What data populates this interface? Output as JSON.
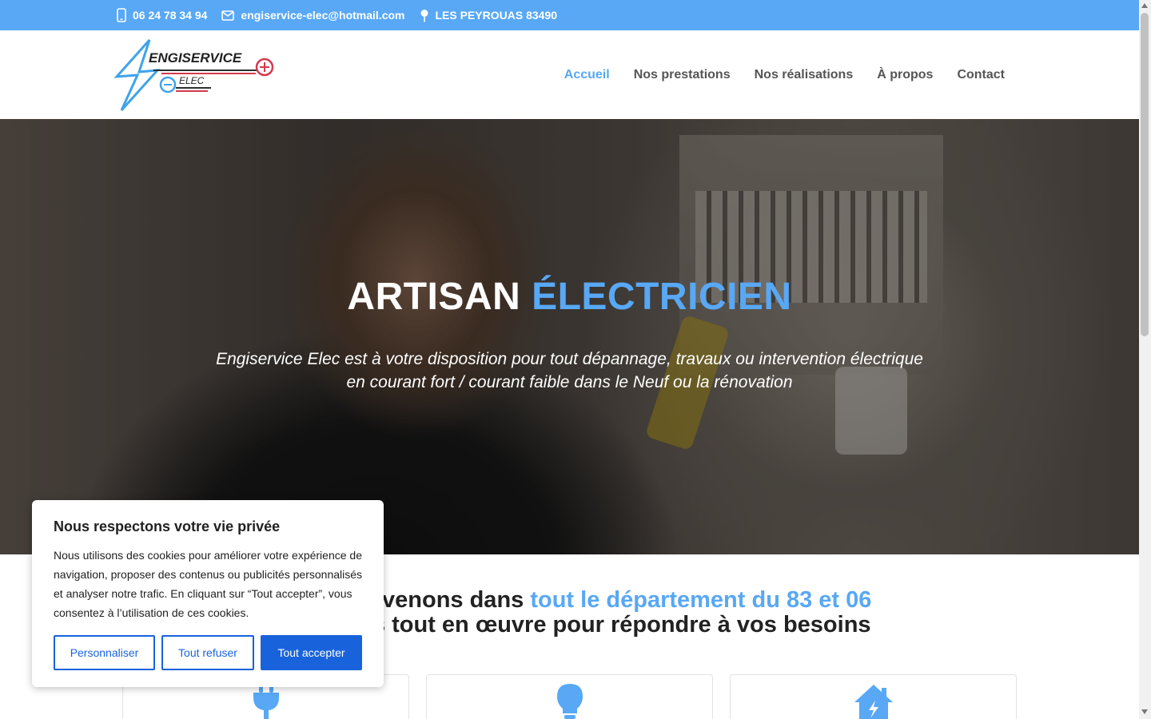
{
  "topbar": {
    "phone": "06 24 78 34 94",
    "email": "engiservice-elec@hotmail.com",
    "address": "LES PEYROUAS 83490"
  },
  "logo": {
    "line1": "ENGISERVICE",
    "line2": "ELEC"
  },
  "nav": {
    "items": [
      {
        "label": "Accueil",
        "active": true
      },
      {
        "label": "Nos prestations",
        "active": false
      },
      {
        "label": "Nos réalisations",
        "active": false
      },
      {
        "label": "À propos",
        "active": false
      },
      {
        "label": "Contact",
        "active": false
      }
    ]
  },
  "hero": {
    "title_part1": "ARTISAN",
    "title_part2": "ÉLECTRICIEN",
    "subtitle_line1": "Engiservice Elec est à votre disposition pour tout dépannage, travaux ou intervention électrique",
    "subtitle_line2": "en courant fort / courant faible dans le Neuf ou la rénovation"
  },
  "intro": {
    "line1_part1": "Nous intervenons dans",
    "line1_part2": "tout le département du 83 et 06",
    "line2": "et mettons tout en œuvre pour répondre à vos besoins"
  },
  "cards": [
    {
      "icon": "plug-icon"
    },
    {
      "icon": "lightbulb-icon"
    },
    {
      "icon": "house-icon"
    }
  ],
  "cookie": {
    "title": "Nous respectons votre vie privée",
    "message": "Nous utilisons des cookies pour améliorer votre expérience de navigation, proposer des contenus ou publicités personnalisés et analyser notre trafic. En cliquant sur “Tout accepter”, vous consentez à l’utilisation de ces cookies.",
    "customize_label": "Personnaliser",
    "reject_label": "Tout refuser",
    "accept_label": "Tout accepter"
  },
  "colors": {
    "accent": "#58a8f5",
    "cookie_button": "#1863dc",
    "text": "#222222"
  }
}
